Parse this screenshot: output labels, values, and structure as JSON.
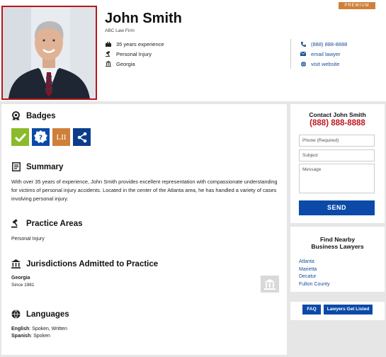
{
  "profile": {
    "premium_label": "PREMIUM",
    "name": "John Smith",
    "firm": "ABC Law Firm",
    "facts": [
      {
        "icon": "briefcase-icon",
        "text": "35 years experience"
      },
      {
        "icon": "gavel-icon",
        "text": "Personal Injury"
      },
      {
        "icon": "courthouse-icon",
        "text": "Georgia"
      }
    ],
    "contacts": [
      {
        "icon": "phone-icon",
        "text": "(888) 888-8888"
      },
      {
        "icon": "email-icon",
        "text": "email lawyer"
      },
      {
        "icon": "globe-icon",
        "text": "visit website"
      }
    ]
  },
  "sections": {
    "badges_title": "Badges",
    "badges": [
      {
        "icon": "checkmark-icon",
        "color": "#8bba2b"
      },
      {
        "icon": "question-seal-icon",
        "color": "#0b4aa8"
      },
      {
        "label": "LII",
        "color": "#d07f3a"
      },
      {
        "icon": "share-network-icon",
        "color": "#0b3d8a"
      }
    ],
    "summary_title": "Summary",
    "summary_text": "With over 35 years of experience, John Smith provides excellent representation with compassionate understanding for victims of personal injury accidents.  Located in the center of the Atlanta area, he has handled a variety of cases involving personal injury.",
    "practice_title": "Practice Areas",
    "practice_text": "Personal Injury",
    "jurisdictions_title": "Jurisdictions Admitted to Practice",
    "jurisdiction_state": "Georgia",
    "jurisdiction_since": "Since 1981",
    "languages_title": "Languages",
    "languages": [
      {
        "language": "English",
        "level": ": Spoken, Written"
      },
      {
        "language": "Spanish",
        "level": ": Spoken"
      }
    ]
  },
  "contact_form": {
    "title": "Contact John Smith",
    "phone": "(888) 888-8888",
    "phone_placeholder": "Phone (Required)",
    "subject_placeholder": "Subject",
    "message_placeholder": "Message",
    "send_label": "SEND"
  },
  "nearby": {
    "title_line1": "Find Nearby",
    "title_line2": "Business Lawyers",
    "cities": [
      "Atlanta",
      "Marietta",
      "Decatur",
      "Fulton County"
    ]
  },
  "footer_buttons": {
    "faq": "FAQ",
    "get_listed": "Lawyers Get Listed"
  },
  "colors": {
    "accent_blue": "#0b4aa8",
    "phone_red": "#c0161f",
    "premium_orange": "#d07f3a"
  }
}
